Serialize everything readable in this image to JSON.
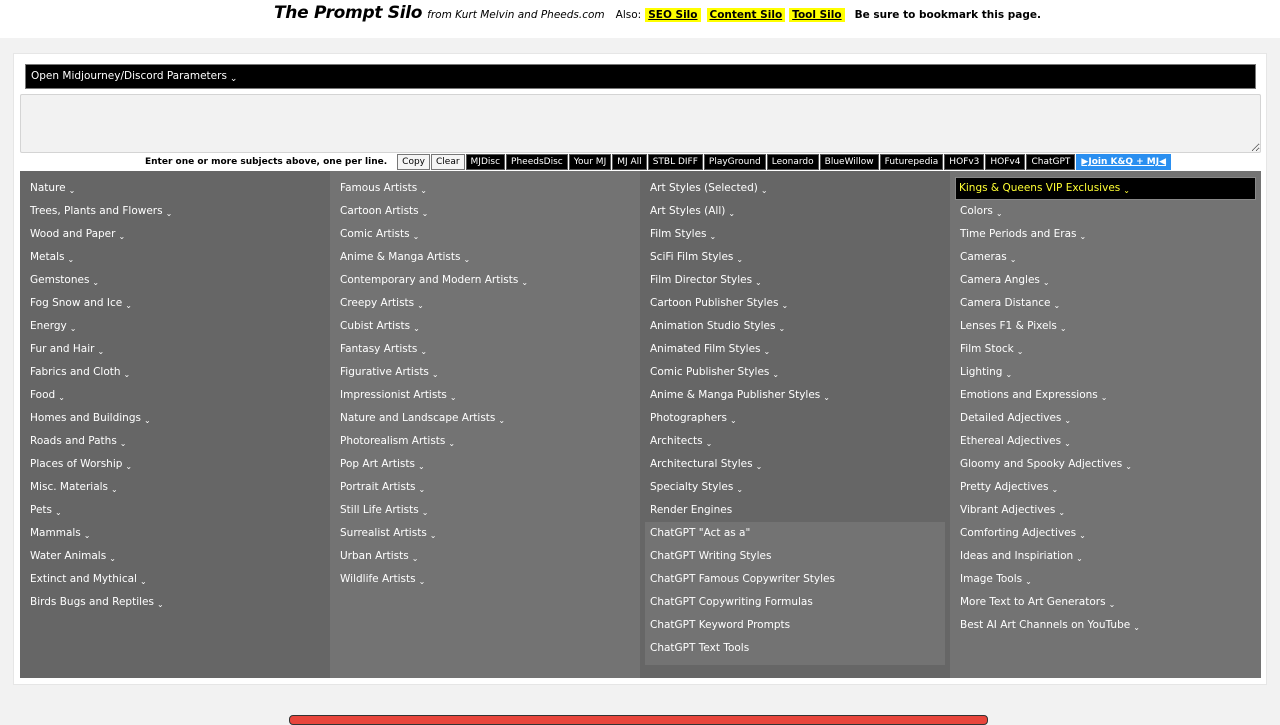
{
  "header": {
    "title": "The Prompt Silo",
    "subtitle": "from Kurt Melvin and Pheeds.com",
    "also_label": "Also:",
    "links": [
      "SEO Silo",
      "Content Silo",
      "Tool Silo"
    ],
    "bookmark_text": "Be sure to bookmark this page."
  },
  "params_bar": {
    "label": "Open Midjourney/Discord Parameters",
    "chevron": "⌄"
  },
  "subject_input": {
    "value": "",
    "placeholder": ""
  },
  "hint": "Enter one or more subjects above, one per line.",
  "buttons": {
    "copy": "Copy",
    "clear": "Clear",
    "tools": [
      "MJDisc",
      "PheedsDisc",
      "Your MJ",
      "MJ All",
      "STBL DIFF",
      "PlayGround",
      "Leonardo",
      "BlueWillow",
      "Futurepedia",
      "HOFv3",
      "HOFv4",
      "ChatGPT"
    ],
    "join": "▶Join K&Q + MJ◀"
  },
  "colors": {
    "vip_text": "#ffff33",
    "join_button": "#2a8ff0",
    "highlight": "#ffff00"
  },
  "columns": {
    "col1": [
      "Nature",
      "Trees, Plants and Flowers",
      "Wood and Paper",
      "Metals",
      "Gemstones",
      "Fog Snow and Ice",
      "Energy",
      "Fur and Hair",
      "Fabrics and Cloth",
      "Food",
      "Homes and Buildings",
      "Roads and Paths",
      "Places of Worship",
      "Misc. Materials",
      "Pets",
      "Mammals",
      "Water Animals",
      "Extinct and Mythical",
      "Birds Bugs and Reptiles"
    ],
    "col2": [
      "Famous Artists",
      "Cartoon Artists",
      "Comic Artists",
      "Anime & Manga Artists",
      "Contemporary and Modern Artists",
      "Creepy Artists",
      "Cubist Artists",
      "Fantasy Artists",
      "Figurative Artists",
      "Impressionist Artists",
      "Nature and Landscape Artists",
      "Photorealism Artists",
      "Pop Art Artists",
      "Portrait Artists",
      "Still Life Artists",
      "Surrealist Artists",
      "Urban Artists",
      "Wildlife Artists"
    ],
    "col3": [
      "Art Styles (Selected)",
      "Art Styles (All)",
      "Film Styles",
      "SciFi Film Styles",
      "Film Director Styles",
      "Cartoon Publisher Styles",
      "Animation Studio Styles",
      "Animated Film Styles",
      "Comic Publisher Styles",
      "Anime & Manga Publisher Styles",
      "Photographers",
      "Architects",
      "Architectural Styles",
      "Specialty Styles"
    ],
    "col3_plain": [
      "Render Engines"
    ],
    "col3_chatgpt": [
      "ChatGPT \"Act as a\"",
      "ChatGPT Writing Styles",
      "ChatGPT Famous Copywriter Styles",
      "ChatGPT Copywriting Formulas",
      "ChatGPT Keyword Prompts",
      "ChatGPT Text Tools"
    ],
    "col4_vip": "Kings & Queens VIP Exclusives",
    "col4": [
      "Colors",
      "Time Periods and Eras",
      "Cameras",
      "Camera Angles",
      "Camera Distance",
      "Lenses F1 & Pixels",
      "Film Stock",
      "Lighting",
      "Emotions and Expressions",
      "Detailed Adjectives",
      "Ethereal Adjectives",
      "Gloomy and Spooky Adjectives",
      "Pretty Adjectives",
      "Vibrant Adjectives",
      "Comforting Adjectives",
      "Ideas and Inspiriation",
      "Image Tools",
      "More Text to Art Generators",
      "Best AI Art Channels on YouTube"
    ]
  }
}
